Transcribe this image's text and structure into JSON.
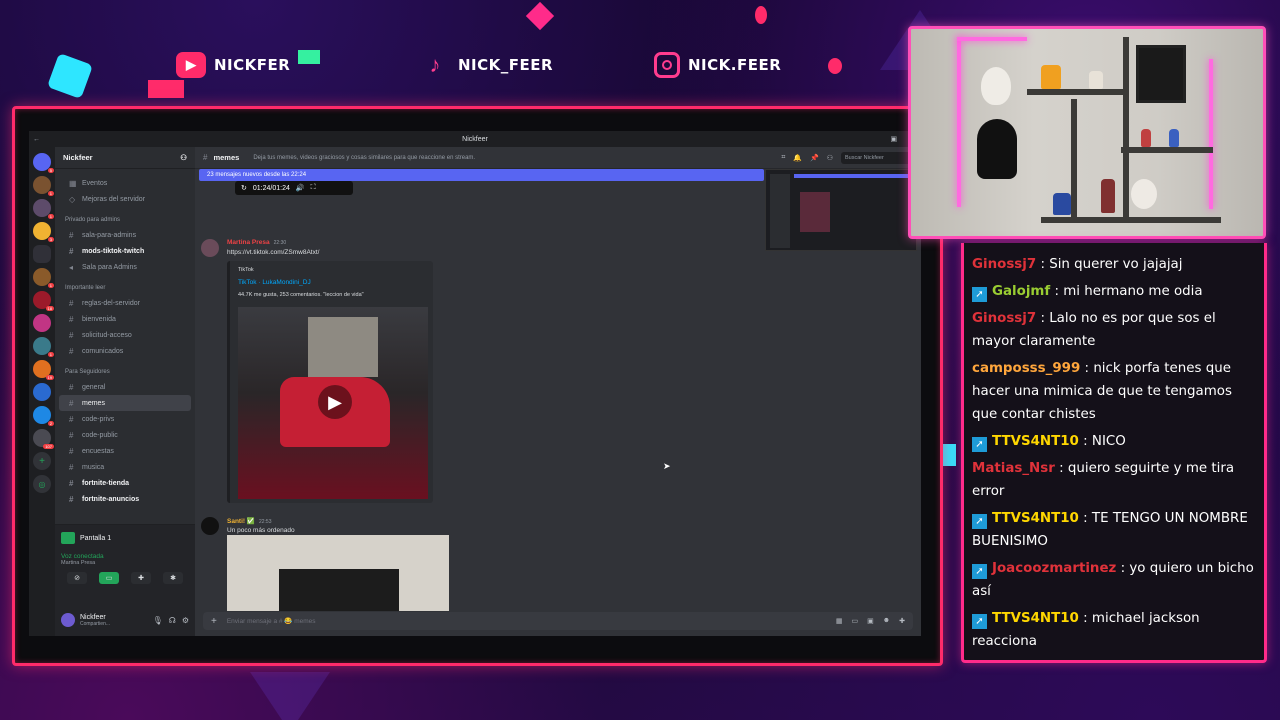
{
  "socials": {
    "youtube": "NICKFER",
    "tiktok": "NICK_FEER",
    "instagram": "NICK.FEER"
  },
  "discord": {
    "window_title": "Nickfeer",
    "server_name": "Nickfeer",
    "channels": {
      "eventos": "Eventos",
      "mejoras": "Mejoras del servidor",
      "cat_privado": "Privado para admins",
      "sala_admins": "sala-para-admins",
      "mods_tiktok": "mods-tiktok-twitch",
      "sala_admins2": "Sala para Admins",
      "cat_importante": "Importante leer",
      "reglas": "reglas-del-servidor",
      "bienvenida": "bienvenida",
      "solicitud": "solicitud-acceso",
      "comunicados": "comunicados",
      "cat_seguidores": "Para Seguidores",
      "general": "general",
      "memes": "memes",
      "code_privs": "code-privs",
      "code_public": "code-public",
      "encuestas": "encuestas",
      "musica": "musica",
      "fortnite_tienda": "fortnite-tienda",
      "fortnite_anuncios": "fortnite-anuncios"
    },
    "voice": {
      "screen_label": "Pantalla 1",
      "status": "Voz conectada",
      "channel": "Martina Presa"
    },
    "user": {
      "name": "Nickfeer",
      "status": "Compartien..."
    },
    "header": {
      "channel": "memes",
      "topic": "Deja tus memes, videos graciosos y cosas similares para que reaccione en stream.",
      "search_placeholder": "Buscar Nickfeer"
    },
    "new_messages": "23 mensajes nuevos desde las 22:24",
    "audio_time": "01:24/01:24",
    "messages": [
      {
        "author": "Martina Presa",
        "time": "22:30",
        "text": "https://vt.tiktok.com/ZSmw8Atxt/",
        "color": "#ed4245"
      },
      {
        "author": "Santi! ✅",
        "time": "22:53",
        "text": "Un poco más ordenado",
        "color": "#f0b232"
      }
    ],
    "embed": {
      "provider": "TikTok",
      "title": "TikTok · LukaMondini_DJ",
      "description": "44.7K me gusta, 253 comentarios. \"leccion de vida\""
    },
    "composer_placeholder": "Enviar mensaje a # 😂 memes"
  },
  "chat": [
    {
      "user": "Ginossj7",
      "color": "#e0323a",
      "text": ": Sin querer vo jajajaj",
      "prime": false
    },
    {
      "user": "Galojmf",
      "color": "#9acd32",
      "text": ": mi hermano me odia",
      "prime": true
    },
    {
      "user": "Ginossj7",
      "color": "#e0323a",
      "text": ": Lalo no es por que sos el mayor claramente",
      "prime": false
    },
    {
      "user": "camposss_999",
      "color": "#ffa63c",
      "text": ": nick porfa tenes que hacer una mimica de que te tengamos que contar chistes",
      "prime": false
    },
    {
      "user": "TTVS4NT10",
      "color": "#ffd700",
      "text": ": NICO",
      "prime": true
    },
    {
      "user": "Matias_Nsr",
      "color": "#e0323a",
      "text": ": quiero seguirte y me tira error",
      "prime": false
    },
    {
      "user": "TTVS4NT10",
      "color": "#ffd700",
      "text": ": TE TENGO UN NOMBRE BUENISIMO",
      "prime": true
    },
    {
      "user": "Joacoozmartinez",
      "color": "#e0323a",
      "text": ": yo quiero un bicho así",
      "prime": true
    },
    {
      "user": "TTVS4NT10",
      "color": "#ffd700",
      "text": ": michael jackson reacciona",
      "prime": true
    }
  ]
}
